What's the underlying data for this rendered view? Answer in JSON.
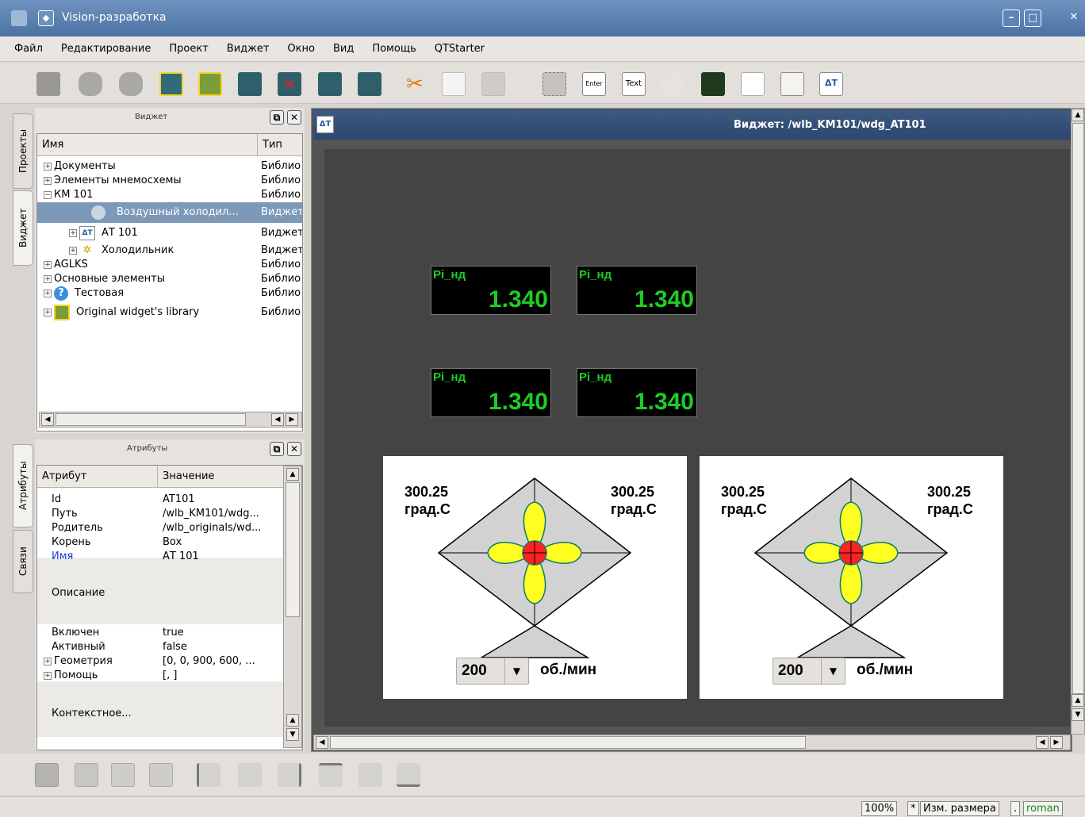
{
  "window": {
    "title": "Vision-разработка"
  },
  "menu": [
    "Файл",
    "Редактирование",
    "Проект",
    "Виджет",
    "Окно",
    "Вид",
    "Помощь",
    "QTStarter"
  ],
  "left_tabs": {
    "projects": "Проекты",
    "widget": "Виджет",
    "attributes": "Атрибуты",
    "links": "Связи"
  },
  "widget_dock": {
    "title": "Виджет",
    "col_name": "Имя",
    "col_type": "Тип",
    "rows": [
      {
        "name": "Документы",
        "type": "Библио"
      },
      {
        "name": "Элементы мнемосхемы",
        "type": "Библио"
      },
      {
        "name": "КМ 101",
        "type": "Библио"
      },
      {
        "name": "Воздушный холодил...",
        "type": "Виджет"
      },
      {
        "name": "АТ 101",
        "type": "Виджет"
      },
      {
        "name": "Холодильник",
        "type": "Виджет"
      },
      {
        "name": "AGLKS",
        "type": "Библио"
      },
      {
        "name": "Основные элементы",
        "type": "Библио"
      },
      {
        "name": "Тестовая",
        "type": "Библио"
      },
      {
        "name": "Original widget's library",
        "type": "Библио"
      }
    ]
  },
  "attr_dock": {
    "title": "Атрибуты",
    "col_attr": "Атрибут",
    "col_value": "Значение",
    "rows": [
      {
        "name": "Id",
        "value": "AT101"
      },
      {
        "name": "Путь",
        "value": "/wlb_KM101/wdg..."
      },
      {
        "name": "Родитель",
        "value": "/wlb_originals/wd..."
      },
      {
        "name": "Корень",
        "value": "Box"
      },
      {
        "name": "Имя",
        "value": "АТ 101"
      },
      {
        "name": "Описание",
        "value": ""
      },
      {
        "name": "Включен",
        "value": "true"
      },
      {
        "name": "Активный",
        "value": "false"
      },
      {
        "name": "Геометрия",
        "value": "[0, 0, 900, 600, ..."
      },
      {
        "name": "Помощь",
        "value": "[, ]"
      },
      {
        "name": "Контекстное...",
        "value": ""
      }
    ]
  },
  "mdi": {
    "title": "Виджет: /wlb_KM101/wdg_AT101"
  },
  "displays": [
    {
      "label": "Pi_нд",
      "value": "1.340"
    },
    {
      "label": "Pi_нд",
      "value": "1.340"
    },
    {
      "label": "Pi_нд",
      "value": "1.340"
    },
    {
      "label": "Pi_нд",
      "value": "1.340"
    }
  ],
  "fans": [
    {
      "temp_left": "300.25",
      "unit_left": "град.С",
      "temp_right": "300.25",
      "unit_right": "град.С",
      "speed": "200",
      "speed_unit": "об./мин"
    },
    {
      "temp_left": "300.25",
      "unit_left": "град.С",
      "temp_right": "300.25",
      "unit_right": "град.С",
      "speed": "200",
      "speed_unit": "об./мин"
    }
  ],
  "status": {
    "zoom": "100%",
    "modified": "*",
    "mode": "Изм. размера",
    "sep": ".",
    "user": "roman"
  },
  "colors": {
    "display_text": "#1ecc26",
    "selection": "#7c99b8",
    "fan_blade": "#ffff22",
    "fan_hub": "#ff2222"
  }
}
